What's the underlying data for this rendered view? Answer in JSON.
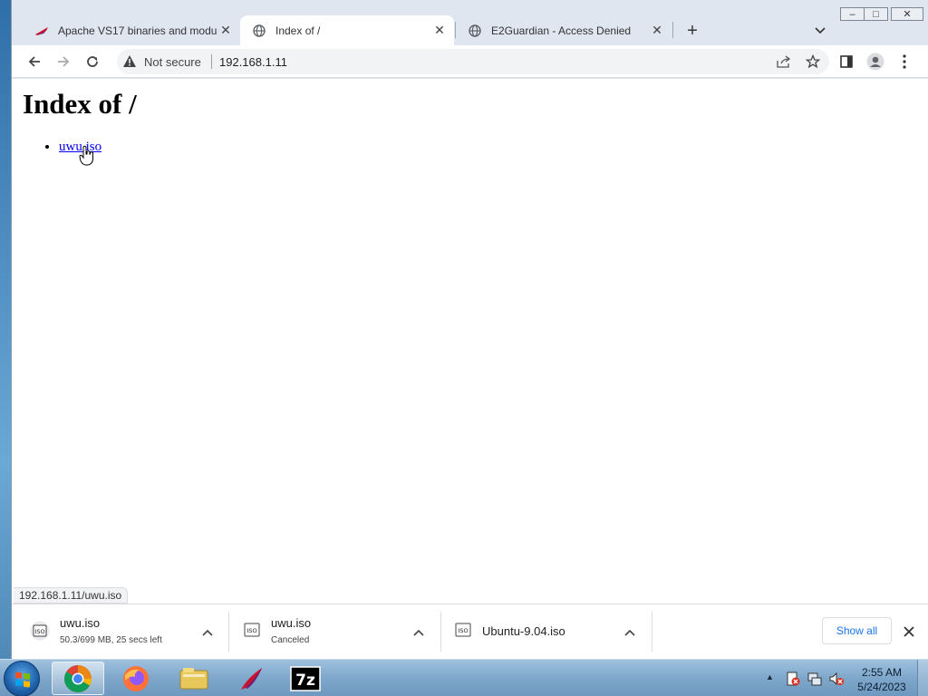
{
  "window": {
    "controls": {
      "minimize": "–",
      "maximize": "□",
      "close": "✕"
    }
  },
  "tabs": [
    {
      "title": "Apache VS17 binaries and modul",
      "favicon": "apache-feather-icon",
      "active": false
    },
    {
      "title": "Index of /",
      "favicon": "globe-icon",
      "active": true
    },
    {
      "title": "E2Guardian - Access Denied",
      "favicon": "globe-icon",
      "active": false
    }
  ],
  "toolbar": {
    "security_label": "Not secure",
    "url": "192.168.1.11"
  },
  "page": {
    "heading": "Index of /",
    "links": [
      {
        "label": "uwu.iso"
      }
    ]
  },
  "status_url": "192.168.1.11/uwu.iso",
  "downloads": [
    {
      "name": "uwu.iso",
      "status": "50.3/699 MB, 25 secs left",
      "icon": "iso-file-icon"
    },
    {
      "name": "uwu.iso",
      "status": "Canceled",
      "icon": "iso-file-icon"
    },
    {
      "name": "Ubuntu-9.04.iso",
      "status": "",
      "icon": "iso-file-icon"
    }
  ],
  "shelf": {
    "show_all": "Show all"
  },
  "taskbar": {
    "apps": [
      "chrome-icon",
      "firefox-icon",
      "file-explorer-icon",
      "apache-feather-icon",
      "7zip-icon"
    ],
    "clock": {
      "time": "2:55 AM",
      "date": "5/24/2023"
    },
    "sevenzip_label": "7z"
  },
  "colors": {
    "link": "#0000ee",
    "accent": "#1a73e8",
    "tab_active": "#ffffff",
    "tabstrip": "#dfe6f0"
  }
}
